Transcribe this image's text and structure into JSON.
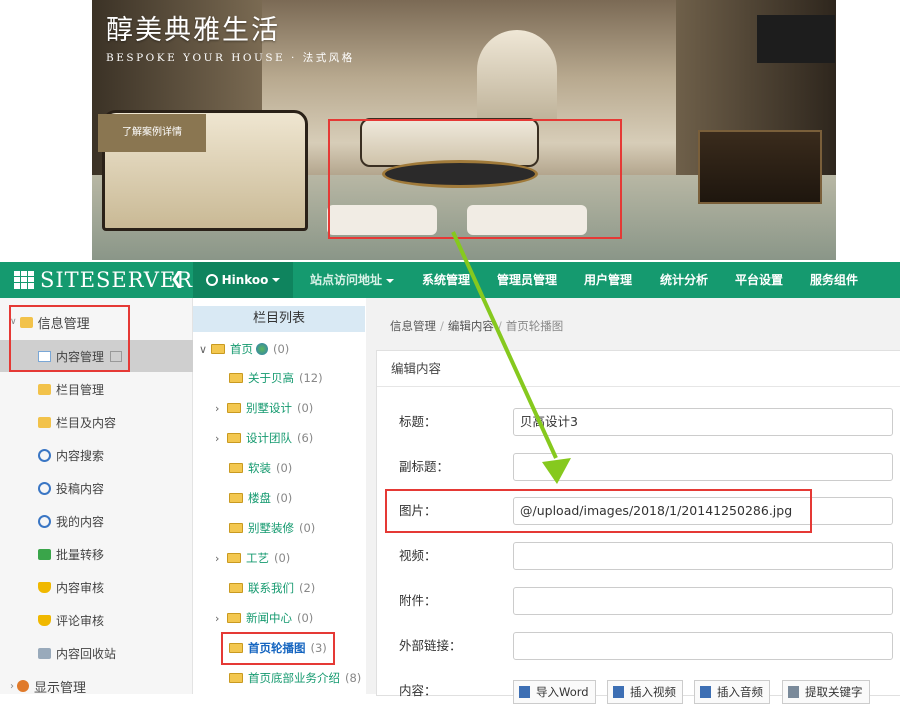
{
  "banner": {
    "title": "醇美典雅生活",
    "subtitle": "BESPOKE YOUR HOUSE · 法式风格",
    "button": "了解案例详情"
  },
  "topnav": {
    "logo": "SITESERVER",
    "back_icon": "arrow-left-icon",
    "site": "Hinkoo",
    "items": [
      "站点访问地址",
      "系统管理",
      "管理员管理",
      "用户管理",
      "统计分析",
      "平台设置",
      "服务组件"
    ]
  },
  "sidebar": {
    "group": "信息管理",
    "items": [
      {
        "label": "内容管理",
        "icon": "content-icon"
      },
      {
        "label": "栏目管理",
        "icon": "folder-icon"
      },
      {
        "label": "栏目及内容",
        "icon": "folder-icon"
      },
      {
        "label": "内容搜索",
        "icon": "search-icon"
      },
      {
        "label": "投稿内容",
        "icon": "search-icon"
      },
      {
        "label": "我的内容",
        "icon": "search-icon"
      },
      {
        "label": "批量转移",
        "icon": "arrow-icon"
      },
      {
        "label": "内容审核",
        "icon": "shield-icon"
      },
      {
        "label": "评论审核",
        "icon": "shield-icon"
      },
      {
        "label": "内容回收站",
        "icon": "recycle-icon"
      }
    ],
    "group2": "显示管理"
  },
  "columns": {
    "header": "栏目列表",
    "tree": [
      {
        "label": "首页",
        "count": "(0)"
      },
      {
        "label": "关于贝高",
        "count": "(12)"
      },
      {
        "label": "别墅设计",
        "count": "(0)"
      },
      {
        "label": "设计团队",
        "count": "(6)"
      },
      {
        "label": "软装",
        "count": "(0)"
      },
      {
        "label": "楼盘",
        "count": "(0)"
      },
      {
        "label": "别墅装修",
        "count": "(0)"
      },
      {
        "label": "工艺",
        "count": "(0)"
      },
      {
        "label": "联系我们",
        "count": "(2)"
      },
      {
        "label": "新闻中心",
        "count": "(0)"
      },
      {
        "label": "首页轮播图",
        "count": "(3)"
      },
      {
        "label": "首页底部业务介绍",
        "count": "(8)"
      }
    ]
  },
  "main": {
    "breadcrumb": [
      "信息管理",
      "编辑内容",
      "首页轮播图"
    ],
    "card_title": "编辑内容",
    "fields": [
      {
        "label": "标题：",
        "value": "贝高设计3"
      },
      {
        "label": "副标题：",
        "value": ""
      },
      {
        "label": "图片：",
        "value": "@/upload/images/2018/1/20141250286.jpg"
      },
      {
        "label": "视频：",
        "value": ""
      },
      {
        "label": "附件：",
        "value": ""
      },
      {
        "label": "外部链接：",
        "value": ""
      },
      {
        "label": "内容：",
        "value": ""
      }
    ],
    "toolbar": [
      "导入Word",
      "插入视频",
      "插入音频",
      "提取关键字"
    ]
  }
}
